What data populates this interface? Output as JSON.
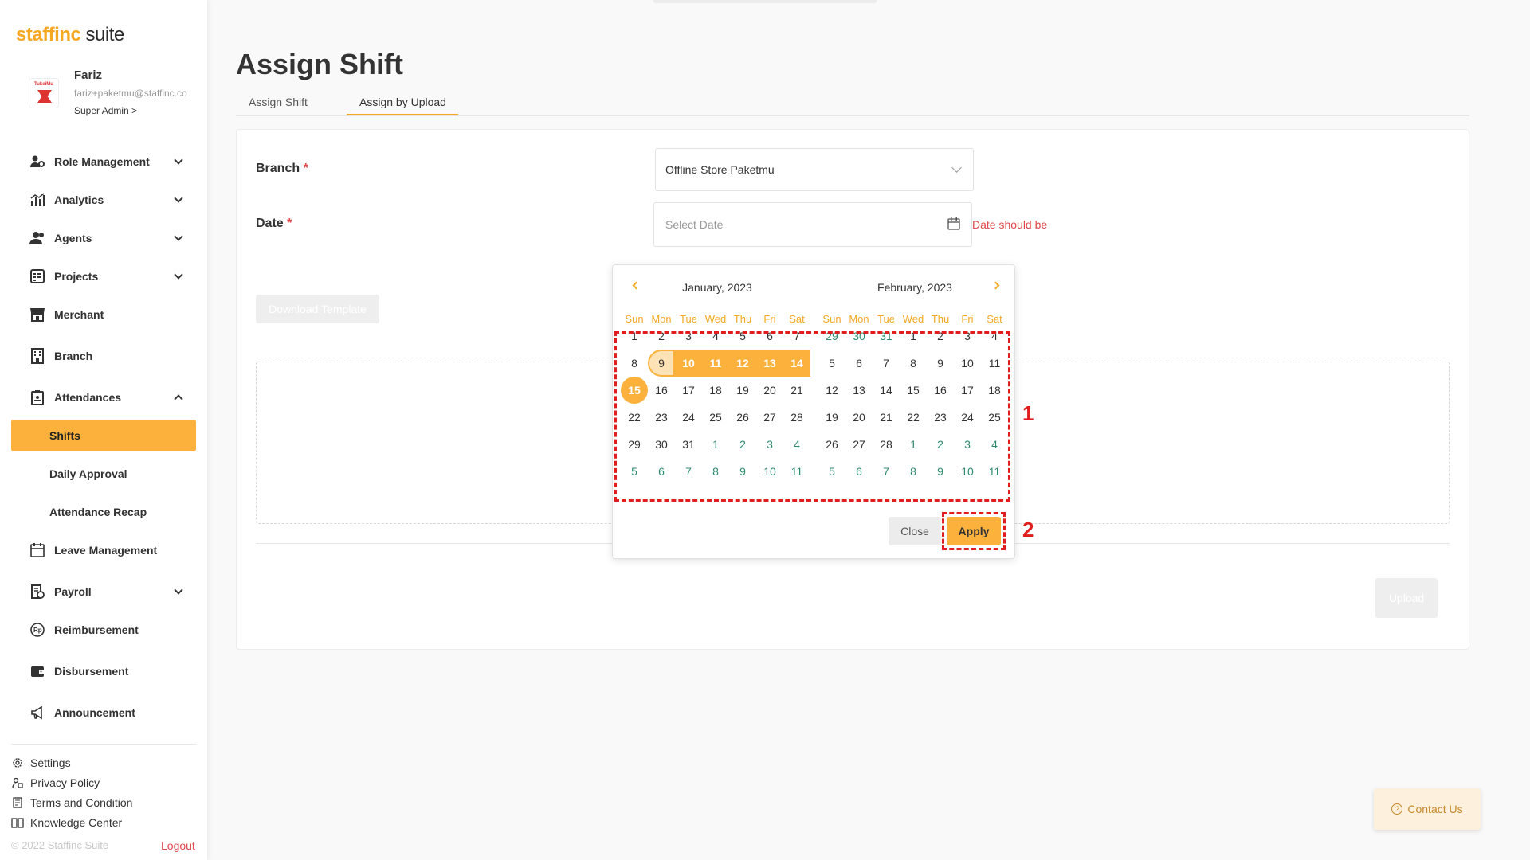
{
  "app": {
    "logo_part1": "staffinc",
    "logo_part2": " suite"
  },
  "profile": {
    "avatar_text": "TukeiMu",
    "name": "Fariz",
    "email": "fariz+paketmu@staffinc.co",
    "role": "Super Admin >"
  },
  "sidebar": {
    "items": [
      {
        "label": "Role Management",
        "icon": "role-management-icon",
        "expandable": true
      },
      {
        "label": "Analytics",
        "icon": "analytics-icon",
        "expandable": true
      },
      {
        "label": "Agents",
        "icon": "agents-icon",
        "expandable": true
      },
      {
        "label": "Projects",
        "icon": "projects-icon",
        "expandable": true
      },
      {
        "label": "Merchant",
        "icon": "merchant-icon",
        "expandable": false
      },
      {
        "label": "Branch",
        "icon": "branch-icon",
        "expandable": false
      },
      {
        "label": "Attendances",
        "icon": "attendances-icon",
        "expandable": true,
        "expanded": true
      },
      {
        "label": "Leave Management",
        "icon": "calendar-icon",
        "expandable": false
      },
      {
        "label": "Payroll",
        "icon": "payroll-icon",
        "expandable": true
      },
      {
        "label": "Reimbursement",
        "icon": "reimbursement-icon",
        "expandable": false
      },
      {
        "label": "Disbursement",
        "icon": "wallet-icon",
        "expandable": false
      },
      {
        "label": "Announcement",
        "icon": "megaphone-icon",
        "expandable": false
      }
    ],
    "sub_items": [
      {
        "label": "Shifts",
        "active": true
      },
      {
        "label": "Daily Approval",
        "active": false
      },
      {
        "label": "Attendance Recap",
        "active": false
      }
    ],
    "footer_links": [
      {
        "label": "Settings",
        "icon": "gear-icon"
      },
      {
        "label": "Privacy Policy",
        "icon": "privacy-icon"
      },
      {
        "label": "Terms and Condition",
        "icon": "document-icon"
      },
      {
        "label": "Knowledge Center",
        "icon": "book-icon"
      }
    ],
    "copyright": "© 2022 Staffinc Suite",
    "logout": "Logout"
  },
  "page": {
    "title": "Assign Shift",
    "tabs": [
      {
        "label": "Assign Shift",
        "active": false
      },
      {
        "label": "Assign by Upload",
        "active": true
      }
    ]
  },
  "form": {
    "branch_label": "Branch",
    "branch_value": "Offline Store Paketmu",
    "date_label": "Date",
    "required_mark": "*",
    "date_placeholder": "Select Date",
    "date_error": "Date should be",
    "download_button": "Download Template",
    "upload_button": "Upload"
  },
  "datepicker": {
    "weekdays": [
      "Sun",
      "Mon",
      "Tue",
      "Wed",
      "Thu",
      "Fri",
      "Sat"
    ],
    "months": [
      {
        "title": "January, 2023",
        "weeks": [
          [
            "1",
            "2",
            "3",
            "4",
            "5",
            "6",
            "7"
          ],
          [
            "8",
            "9",
            "10",
            "11",
            "12",
            "13",
            "14"
          ],
          [
            "15",
            "16",
            "17",
            "18",
            "19",
            "20",
            "21"
          ],
          [
            "22",
            "23",
            "24",
            "25",
            "26",
            "27",
            "28"
          ],
          [
            "29",
            "30",
            "31",
            "1",
            "2",
            "3",
            "4"
          ],
          [
            "5",
            "6",
            "7",
            "8",
            "9",
            "10",
            "11"
          ]
        ],
        "other_month": [
          [
            4,
            3
          ],
          [
            4,
            4
          ],
          [
            4,
            5
          ],
          [
            4,
            6
          ],
          [
            5,
            0
          ],
          [
            5,
            1
          ],
          [
            5,
            2
          ],
          [
            5,
            3
          ],
          [
            5,
            4
          ],
          [
            5,
            5
          ],
          [
            5,
            6
          ]
        ],
        "range_start": [
          1,
          1
        ],
        "range_mid": [
          [
            1,
            2
          ],
          [
            1,
            3
          ],
          [
            1,
            4
          ],
          [
            1,
            5
          ],
          [
            1,
            6
          ]
        ],
        "range_end": [
          2,
          0
        ]
      },
      {
        "title": "February, 2023",
        "weeks": [
          [
            "29",
            "30",
            "31",
            "1",
            "2",
            "3",
            "4"
          ],
          [
            "5",
            "6",
            "7",
            "8",
            "9",
            "10",
            "11"
          ],
          [
            "12",
            "13",
            "14",
            "15",
            "16",
            "17",
            "18"
          ],
          [
            "19",
            "20",
            "21",
            "22",
            "23",
            "24",
            "25"
          ],
          [
            "26",
            "27",
            "28",
            "1",
            "2",
            "3",
            "4"
          ],
          [
            "5",
            "6",
            "7",
            "8",
            "9",
            "10",
            "11"
          ]
        ],
        "other_month": [
          [
            0,
            0
          ],
          [
            0,
            1
          ],
          [
            0,
            2
          ],
          [
            4,
            3
          ],
          [
            4,
            4
          ],
          [
            4,
            5
          ],
          [
            4,
            6
          ],
          [
            5,
            0
          ],
          [
            5,
            1
          ],
          [
            5,
            2
          ],
          [
            5,
            3
          ],
          [
            5,
            4
          ],
          [
            5,
            5
          ],
          [
            5,
            6
          ]
        ]
      }
    ],
    "close_button": "Close",
    "apply_button": "Apply"
  },
  "annotations": [
    {
      "number": "1",
      "color": "#e11d1d"
    },
    {
      "number": "2",
      "color": "#e11d1d"
    }
  ],
  "contact": {
    "label": "Contact Us",
    "icon": "question-icon"
  },
  "colors": {
    "accent": "#fbb13c",
    "accent_text": "#f7a823",
    "error": "#e2484a",
    "other_month": "#2e8b6e"
  }
}
